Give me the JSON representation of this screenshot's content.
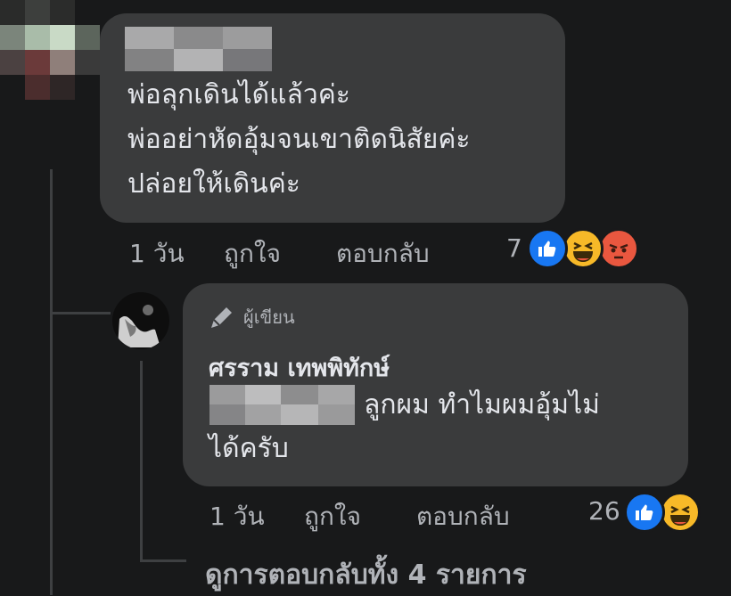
{
  "comment1": {
    "lines": [
      "พ่อลุกเดินได้แล้วค่ะ",
      "พ่ออย่าหัดอุ้มจนเขาติดนิสัยค่ะ",
      "ปล่อยให้เดินค่ะ"
    ],
    "time": "1 วัน",
    "like_label": "ถูกใจ",
    "reply_label": "ตอบกลับ",
    "reaction_count": "7",
    "reactions": [
      "like-icon",
      "haha-icon",
      "angry-icon"
    ]
  },
  "reply1": {
    "badge": "ผู้เขียน",
    "author": "ศรราม เทพพิทักษ์",
    "line1": "ลูกผม ทำไมผมอุ้มไม่",
    "line2": "ได้ครับ",
    "time": "1 วัน",
    "like_label": "ถูกใจ",
    "reply_label": "ตอบกลับ",
    "reaction_count": "26",
    "reactions": [
      "like-icon",
      "haha-icon"
    ]
  },
  "view_replies": "ดูการตอบกลับทั้ง 4 รายการ",
  "colors": {
    "background": "#18191a",
    "bubble": "#3a3b3c",
    "text": "#e4e6eb",
    "secondary_text": "#b0b3b8",
    "like_blue": "#1877f2",
    "haha_yellow": "#f7b928",
    "angry_red": "#e9573f"
  }
}
